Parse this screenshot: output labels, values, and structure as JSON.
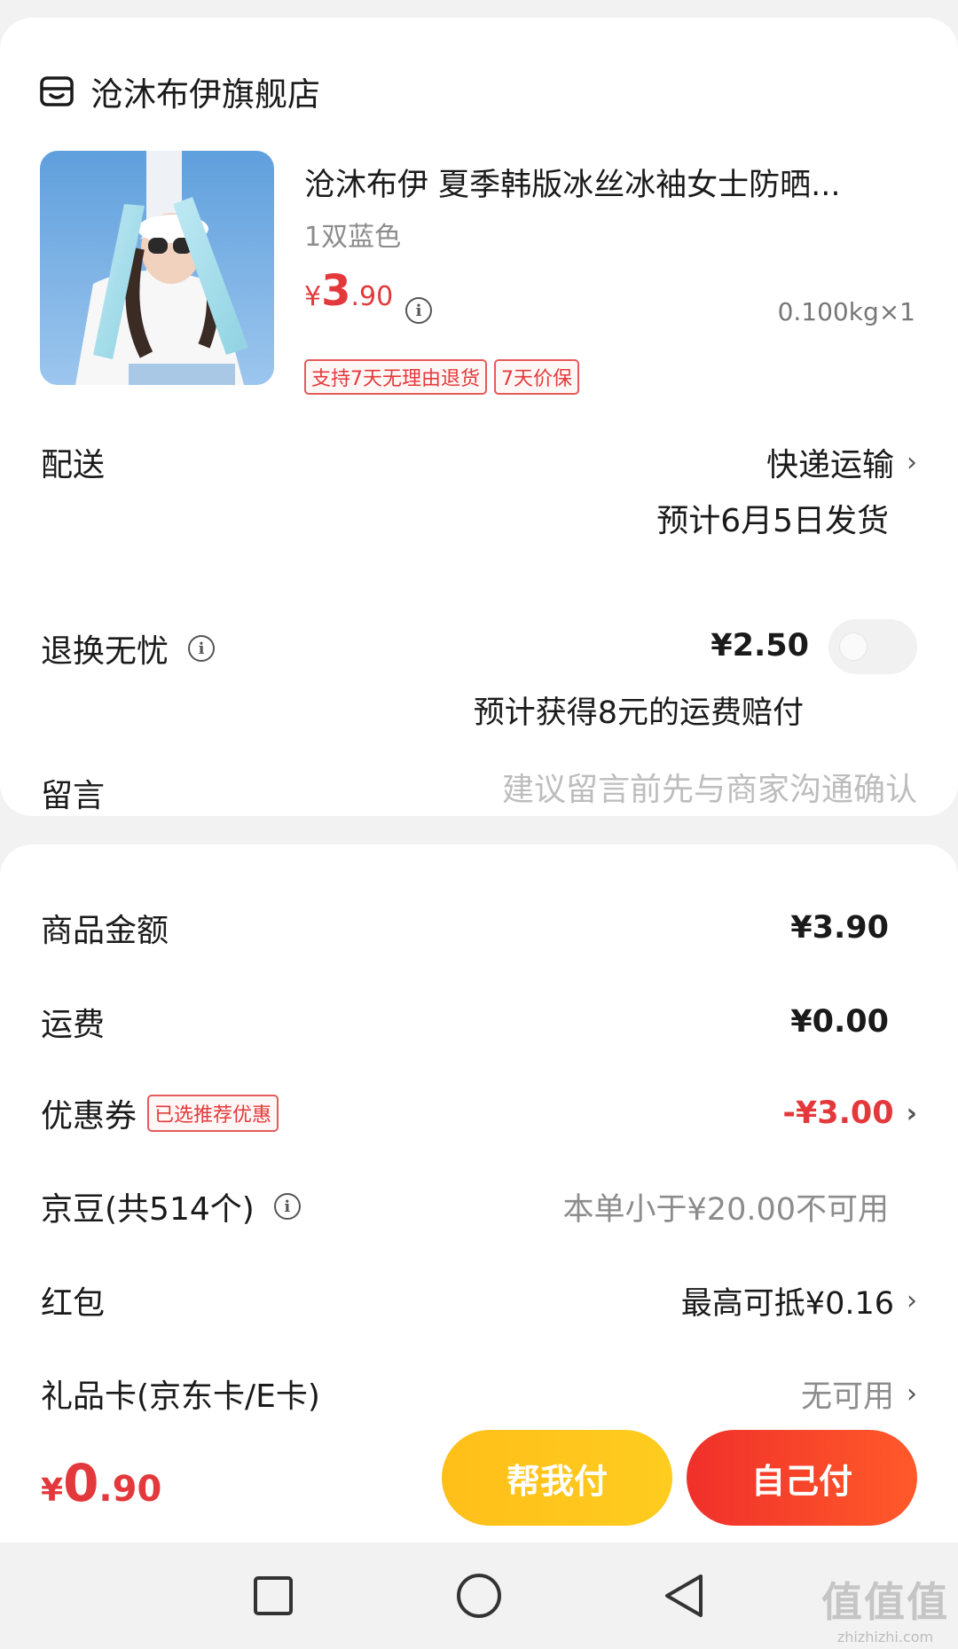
{
  "shop": {
    "name": "沧沐布伊旗舰店",
    "icon": "shop-icon"
  },
  "product": {
    "title": "沧沐布伊 夏季韩版冰丝冰袖女士防晒...",
    "spec": "1双蓝色",
    "price_currency": "¥",
    "price_int": "3",
    "price_dec": ".90",
    "weight": "0.100kg×1",
    "tags": [
      "支持7天无理由退货",
      "7天价保"
    ]
  },
  "delivery": {
    "label": "配送",
    "method": "快递运输",
    "eta": "预计6月5日发货"
  },
  "return_service": {
    "label": "退换无忧",
    "price": "¥2.50",
    "note": "预计获得8元的运费赔付",
    "enabled": false
  },
  "message": {
    "label": "留言",
    "placeholder": "建议留言前先与商家沟通确认"
  },
  "summary": {
    "goods": {
      "label": "商品金额",
      "value": "¥3.90"
    },
    "shipping": {
      "label": "运费",
      "value": "¥0.00"
    },
    "coupon": {
      "label": "优惠券",
      "badge": "已选推荐优惠",
      "value": "-¥3.00"
    },
    "beans": {
      "label": "京豆(共514个)",
      "value": "本单小于¥20.00不可用"
    },
    "redpacket": {
      "label": "红包",
      "value": "最高可抵¥0.16"
    },
    "giftcard": {
      "label": "礼品卡(京东卡/E卡)",
      "value": "无可用"
    }
  },
  "bottom": {
    "total_currency": "¥",
    "total_int": "0",
    "total_dec": ".90",
    "help_pay": "帮我付",
    "self_pay": "自己付"
  },
  "watermark": {
    "big": "值值值",
    "small": "zhizhizhi.com"
  },
  "colors": {
    "accent_red": "#e4393c",
    "help_yellow": "#ffc41c",
    "self_red": "#f5372b"
  }
}
